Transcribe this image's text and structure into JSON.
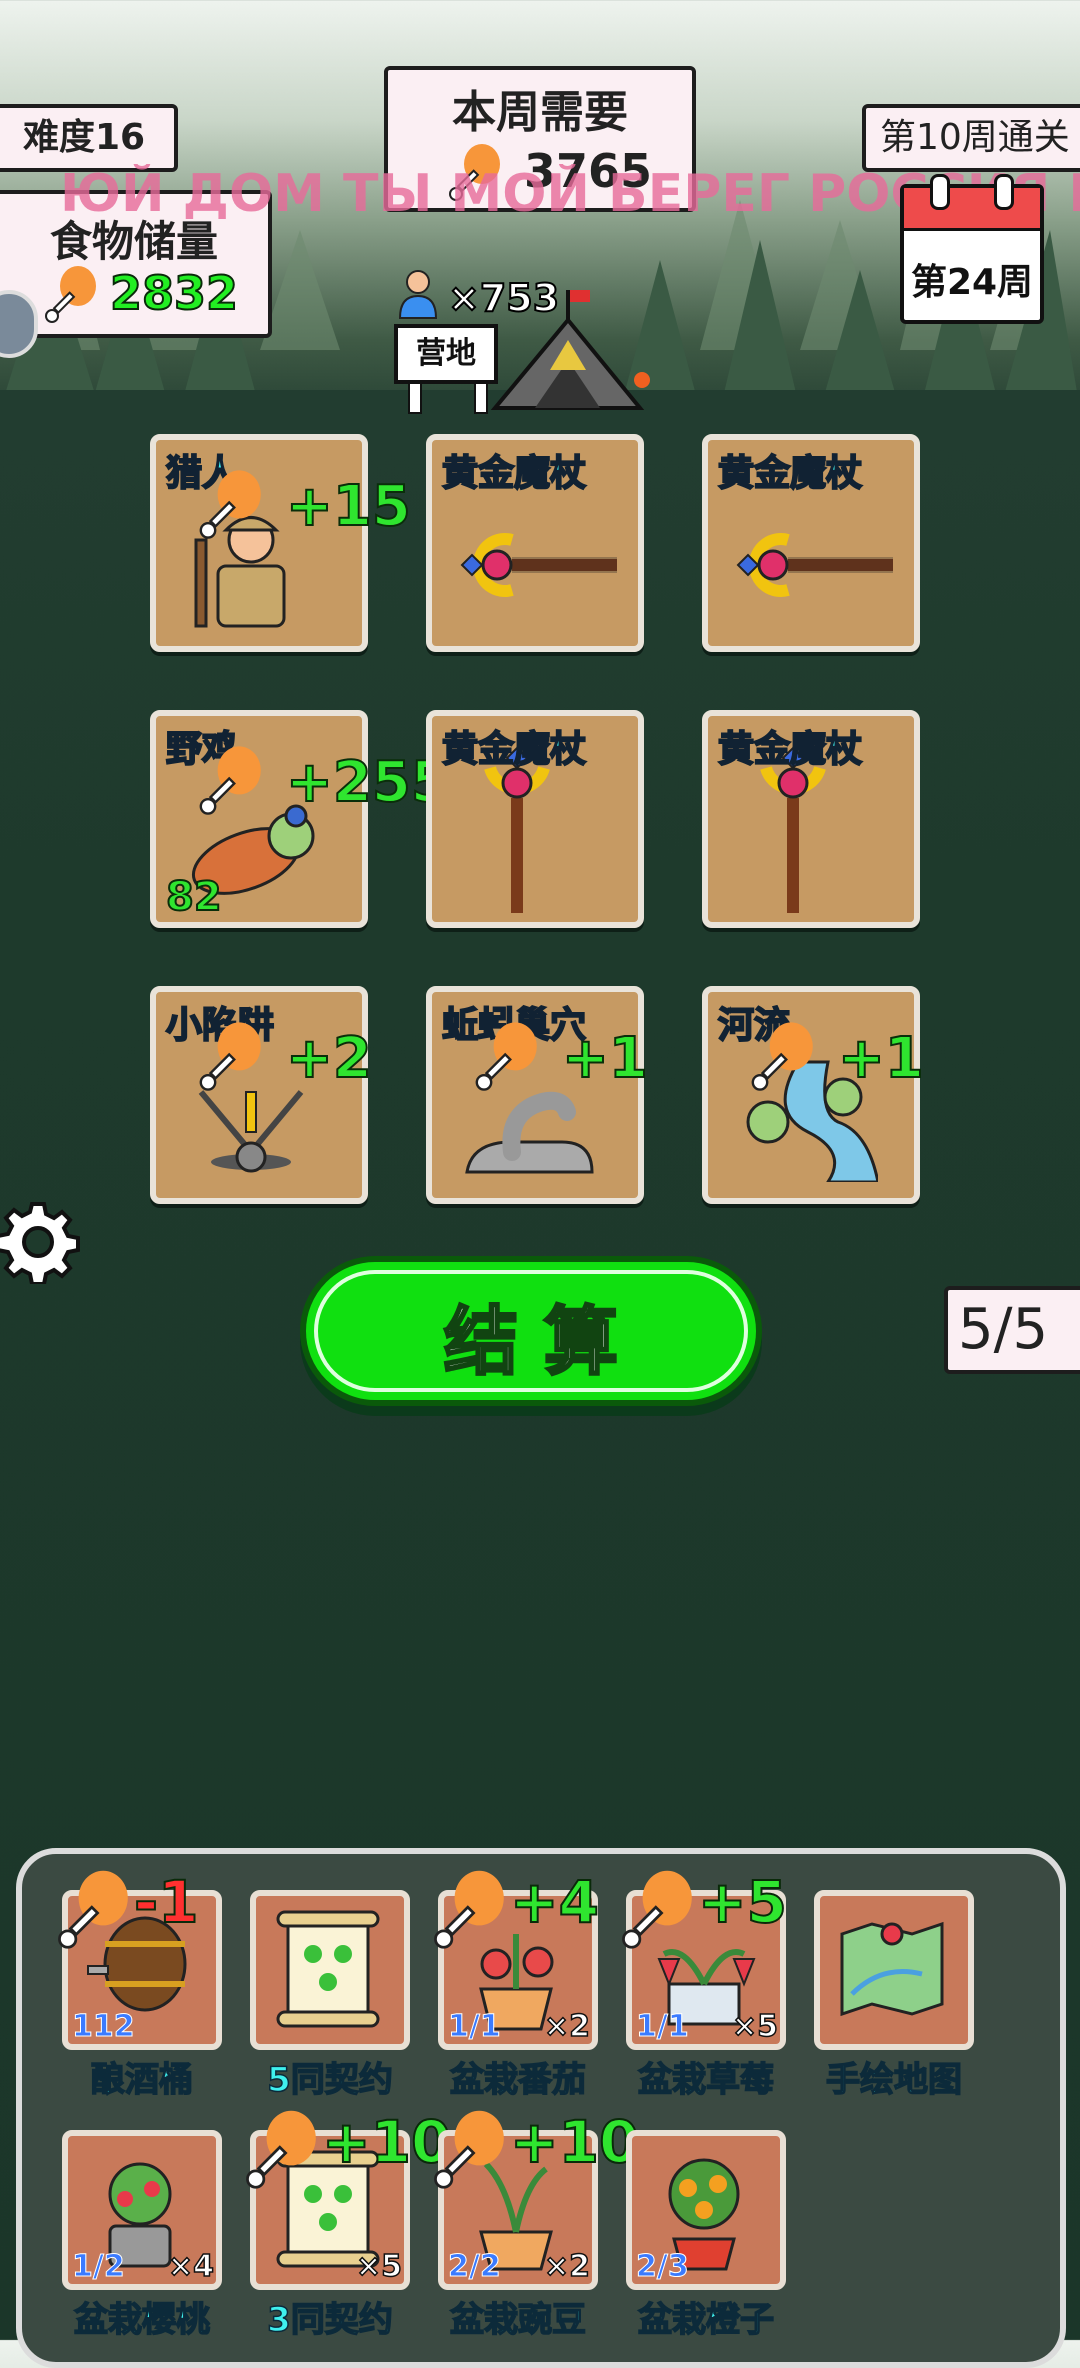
{
  "difficulty": "难度16",
  "weekly_need": {
    "title": "本周需要",
    "value": "3765"
  },
  "clear_status": "第10周通关",
  "food_storage": {
    "title": "食物储量",
    "value": "2832"
  },
  "banner_text": "ЮЙ ДОМ ТЫ МОЙ БЕРЕГ РОССИЯ МОЯ",
  "calendar": {
    "week": "第24周"
  },
  "population": "×753",
  "camp_label": "营地",
  "cards": [
    {
      "name": "猎人",
      "bonus": "+15",
      "icon": "hunter-icon"
    },
    {
      "name": "黄金魔杖",
      "bonus": "",
      "icon": "golden-wand-icon"
    },
    {
      "name": "黄金魔杖",
      "bonus": "",
      "icon": "golden-wand-icon"
    },
    {
      "name": "野鸡",
      "bonus": "+255",
      "counter": "82",
      "icon": "pheasant-icon"
    },
    {
      "name": "黄金魔杖",
      "bonus": "",
      "icon": "golden-wand-icon"
    },
    {
      "name": "黄金魔杖",
      "bonus": "",
      "icon": "golden-wand-icon"
    },
    {
      "name": "小陷阱",
      "bonus": "+2",
      "icon": "trap-icon"
    },
    {
      "name": "蚯蚓巢穴",
      "bonus": "+1",
      "icon": "worm-nest-icon"
    },
    {
      "name": "河流",
      "bonus": "+1",
      "icon": "river-icon"
    }
  ],
  "settle_button": "结 算",
  "page_counter": "5/5",
  "inventory": [
    {
      "name": "酿酒桶",
      "count": "112",
      "mult": "",
      "bonus": "-1",
      "bonus_color": "#ff3030",
      "icon": "barrel-icon"
    },
    {
      "name": "5同契约",
      "count": "",
      "mult": "",
      "bonus": "",
      "icon": "scroll-icon"
    },
    {
      "name": "盆栽番茄",
      "count": "1/1",
      "mult": "×2",
      "bonus": "+4",
      "bonus_color": "#2fe52f",
      "icon": "potted-tomato-icon"
    },
    {
      "name": "盆栽草莓",
      "count": "1/1",
      "mult": "×5",
      "bonus": "+5",
      "bonus_color": "#2fe52f",
      "icon": "potted-strawberry-icon"
    },
    {
      "name": "手绘地图",
      "count": "",
      "mult": "",
      "bonus": "",
      "icon": "map-icon"
    },
    {
      "name": "盆栽樱桃",
      "count": "1/2",
      "mult": "×4",
      "bonus": "",
      "icon": "potted-cherry-icon"
    },
    {
      "name": "3同契约",
      "count": "",
      "mult": "×5",
      "bonus": "+10",
      "bonus_color": "#2fe52f",
      "icon": "scroll-icon"
    },
    {
      "name": "盆栽豌豆",
      "count": "2/2",
      "mult": "×2",
      "bonus": "+10",
      "bonus_color": "#2fe52f",
      "icon": "potted-pea-icon"
    },
    {
      "name": "盆栽橙子",
      "count": "2/3",
      "mult": "",
      "bonus": "",
      "icon": "potted-orange-icon"
    }
  ]
}
